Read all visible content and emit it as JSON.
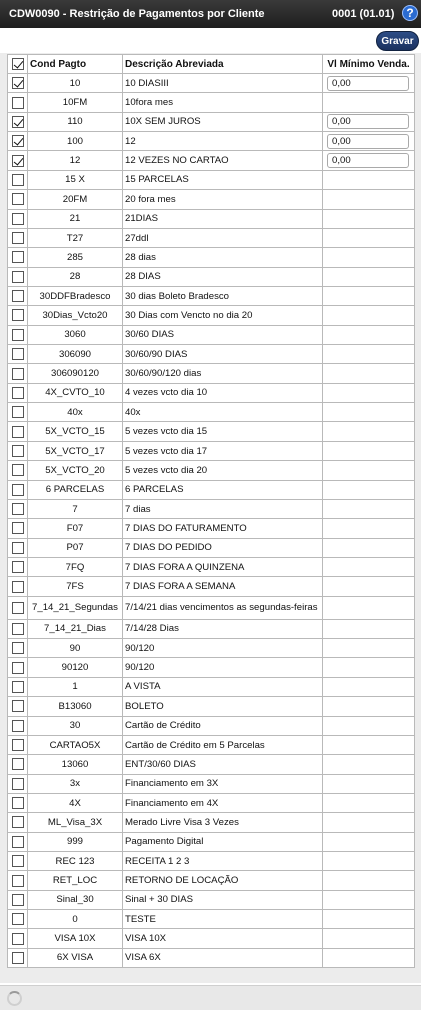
{
  "window": {
    "title": "CDW0090 - Restrição de Pagamentos por Cliente",
    "version": "0001 (01.01)",
    "help_icon": "question-circle-icon",
    "help_glyph": "?"
  },
  "toolbar": {
    "save_label": "Gravar"
  },
  "table": {
    "columns": {
      "code": "Cond Pagto",
      "description": "Descrição Abreviada",
      "min_value": "Vl Mínimo Venda."
    },
    "header_checked": true,
    "rows": [
      {
        "checked": true,
        "code": "10",
        "description": "10 DIASIII",
        "min_value": "0,00"
      },
      {
        "checked": false,
        "code": "10FM",
        "description": "10fora mes",
        "min_value": null
      },
      {
        "checked": true,
        "code": "110",
        "description": "10X SEM JUROS",
        "min_value": "0,00"
      },
      {
        "checked": true,
        "code": "100",
        "description": "12",
        "min_value": "0,00"
      },
      {
        "checked": true,
        "code": "12",
        "description": "12 VEZES NO CARTAO",
        "min_value": "0,00"
      },
      {
        "checked": false,
        "code": "15 X",
        "description": "15 PARCELAS",
        "min_value": null
      },
      {
        "checked": false,
        "code": "20FM",
        "description": "20 fora mes",
        "min_value": null
      },
      {
        "checked": false,
        "code": "21",
        "description": "21DIAS",
        "min_value": null
      },
      {
        "checked": false,
        "code": "T27",
        "description": "27ddl",
        "min_value": null
      },
      {
        "checked": false,
        "code": "285",
        "description": "28 dias",
        "min_value": null
      },
      {
        "checked": false,
        "code": "28",
        "description": "28 DIAS",
        "min_value": null
      },
      {
        "checked": false,
        "code": "30DDFBradesco",
        "description": "30 dias Boleto Bradesco",
        "min_value": null
      },
      {
        "checked": false,
        "code": "30Dias_Vcto20",
        "description": "30 Dias com Vencto no dia 20",
        "min_value": null
      },
      {
        "checked": false,
        "code": "3060",
        "description": "30/60 DIAS",
        "min_value": null
      },
      {
        "checked": false,
        "code": "306090",
        "description": "30/60/90 DIAS",
        "min_value": null
      },
      {
        "checked": false,
        "code": "306090120",
        "description": "30/60/90/120 dias",
        "min_value": null
      },
      {
        "checked": false,
        "code": "4X_CVTO_10",
        "description": "4 vezes vcto dia 10",
        "min_value": null
      },
      {
        "checked": false,
        "code": "40x",
        "description": "40x",
        "min_value": null
      },
      {
        "checked": false,
        "code": "5X_VCTO_15",
        "description": "5 vezes vcto dia 15",
        "min_value": null
      },
      {
        "checked": false,
        "code": "5X_VCTO_17",
        "description": "5 vezes vcto dia 17",
        "min_value": null
      },
      {
        "checked": false,
        "code": "5X_VCTO_20",
        "description": "5 vezes vcto dia 20",
        "min_value": null
      },
      {
        "checked": false,
        "code": "6 PARCELAS",
        "description": "6 PARCELAS",
        "min_value": null
      },
      {
        "checked": false,
        "code": "7",
        "description": "7 dias",
        "min_value": null
      },
      {
        "checked": false,
        "code": "F07",
        "description": "7 DIAS DO FATURAMENTO",
        "min_value": null
      },
      {
        "checked": false,
        "code": "P07",
        "description": "7 DIAS DO PEDIDO",
        "min_value": null
      },
      {
        "checked": false,
        "code": "7FQ",
        "description": "7 DIAS FORA A QUINZENA",
        "min_value": null
      },
      {
        "checked": false,
        "code": "7FS",
        "description": "7 DIAS FORA A SEMANA",
        "min_value": null
      },
      {
        "checked": false,
        "code": "7_14_21_Segundas",
        "description": "7/14/21 dias vencimentos as segundas-feiras",
        "min_value": null
      },
      {
        "checked": false,
        "code": "7_14_21_Dias",
        "description": "7/14/28 Dias",
        "min_value": null
      },
      {
        "checked": false,
        "code": "90",
        "description": "90/120",
        "min_value": null
      },
      {
        "checked": false,
        "code": "90120",
        "description": "90/120",
        "min_value": null
      },
      {
        "checked": false,
        "code": "1",
        "description": "A VISTA",
        "min_value": null
      },
      {
        "checked": false,
        "code": "B13060",
        "description": "BOLETO",
        "min_value": null
      },
      {
        "checked": false,
        "code": "30",
        "description": "Cartão de Crédito",
        "min_value": null
      },
      {
        "checked": false,
        "code": "CARTAO5X",
        "description": "Cartão de Crédito em 5 Parcelas",
        "min_value": null
      },
      {
        "checked": false,
        "code": "13060",
        "description": "ENT/30/60 DIAS",
        "min_value": null
      },
      {
        "checked": false,
        "code": "3x",
        "description": "Financiamento em 3X",
        "min_value": null
      },
      {
        "checked": false,
        "code": "4X",
        "description": "Financiamento em 4X",
        "min_value": null
      },
      {
        "checked": false,
        "code": "ML_Visa_3X",
        "description": "Merado Livre Visa 3 Vezes",
        "min_value": null
      },
      {
        "checked": false,
        "code": "999",
        "description": "Pagamento Digital",
        "min_value": null
      },
      {
        "checked": false,
        "code": "REC 123",
        "description": "RECEITA 1 2 3",
        "min_value": null
      },
      {
        "checked": false,
        "code": "RET_LOC",
        "description": "RETORNO DE LOCAÇÃO",
        "min_value": null
      },
      {
        "checked": false,
        "code": "Sinal_30",
        "description": "Sinal + 30 DIAS",
        "min_value": null
      },
      {
        "checked": false,
        "code": "0",
        "description": "TESTE",
        "min_value": null
      },
      {
        "checked": false,
        "code": "VISA 10X",
        "description": "VISA 10X",
        "min_value": null
      },
      {
        "checked": false,
        "code": "6X VISA",
        "description": "VISA 6X",
        "min_value": null
      }
    ]
  },
  "status": {
    "loading_icon": "spinner-icon"
  }
}
